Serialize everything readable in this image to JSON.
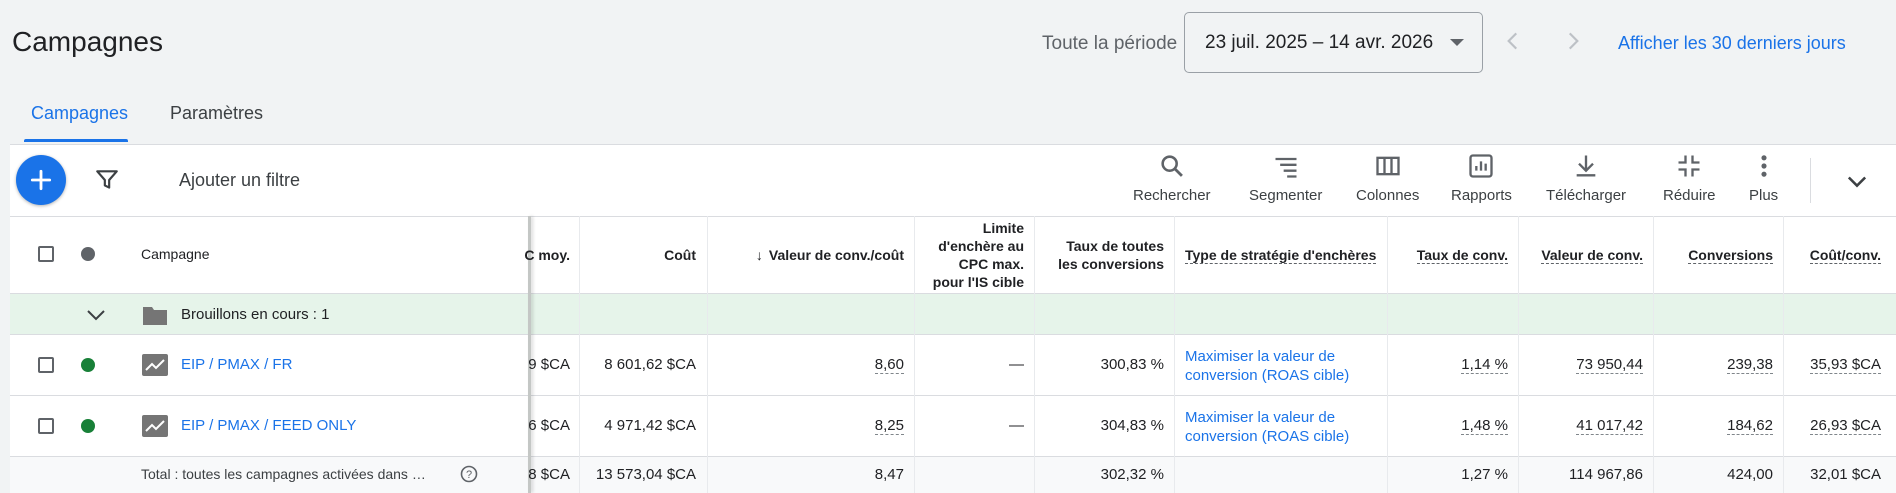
{
  "header": {
    "title": "Campagnes",
    "period_label": "Toute la période",
    "date_range": "23 juil. 2025 – 14 avr. 2026",
    "last_30_link": "Afficher les 30 derniers jours"
  },
  "tabs": [
    {
      "label": "Campagnes",
      "active": true
    },
    {
      "label": "Paramètres",
      "active": false
    }
  ],
  "toolbar": {
    "add_filter": "Ajouter un filtre",
    "tools": [
      {
        "icon": "search-icon",
        "label": "Rechercher"
      },
      {
        "icon": "segment-icon",
        "label": "Segmenter"
      },
      {
        "icon": "columns-icon",
        "label": "Colonnes"
      },
      {
        "icon": "reports-icon",
        "label": "Rapports"
      },
      {
        "icon": "download-icon",
        "label": "Télécharger"
      },
      {
        "icon": "collapse-icon",
        "label": "Réduire"
      },
      {
        "icon": "more-icon",
        "label": "Plus"
      }
    ]
  },
  "table": {
    "headers": {
      "campaign": "Campagne",
      "cpc_avg": "C moy.",
      "cost": "Coût",
      "conv_value_cost": "Valeur de conv./coût",
      "bid_limit_1": "Limite",
      "bid_limit_2": "d'enchère au",
      "bid_limit_3": "CPC max.",
      "bid_limit_4": "pour l'IS cible",
      "all_conv_rate_1": "Taux de toutes",
      "all_conv_rate_2": "les conversions",
      "strategy_type": "Type de stratégie d'enchères",
      "conv_rate": "Taux de conv.",
      "conv_value": "Valeur de conv.",
      "conversions": "Conversions",
      "cost_per_conv": "Coût/conv."
    },
    "drafts_label": "Brouillons en cours : 1",
    "rows": [
      {
        "name": "EIP / PMAX / FR",
        "cpc_avg": "9 $CA",
        "cost": "8 601,62 $CA",
        "conv_value_cost": "8,60",
        "bid_limit": "—",
        "all_conv_rate": "300,83 %",
        "strategy_1": "Maximiser la valeur de",
        "strategy_2": "conversion (ROAS cible)",
        "conv_rate": "1,14 %",
        "conv_value": "73 950,44",
        "conversions": "239,38",
        "cost_per_conv": "35,93 $CA",
        "status_color": "#188038"
      },
      {
        "name": "EIP / PMAX / FEED ONLY",
        "cpc_avg": "6 $CA",
        "cost": "4 971,42 $CA",
        "conv_value_cost": "8,25",
        "bid_limit": "—",
        "all_conv_rate": "304,83 %",
        "strategy_1": "Maximiser la valeur de",
        "strategy_2": "conversion (ROAS cible)",
        "conv_rate": "1,48 %",
        "conv_value": "41 017,42",
        "conversions": "184,62",
        "cost_per_conv": "26,93 $CA",
        "status_color": "#188038"
      }
    ],
    "total": {
      "label": "Total : toutes les campagnes activées dans …",
      "cpc_avg": "8 $CA",
      "cost": "13 573,04 $CA",
      "conv_value_cost": "8,47",
      "all_conv_rate": "302,32 %",
      "conv_rate": "1,27 %",
      "conv_value": "114 967,86",
      "conversions": "424,00",
      "cost_per_conv": "32,01 $CA"
    }
  },
  "colors": {
    "accent": "#1a73e8",
    "enabled_green": "#188038",
    "drafts_bg": "#e6f4ea"
  }
}
